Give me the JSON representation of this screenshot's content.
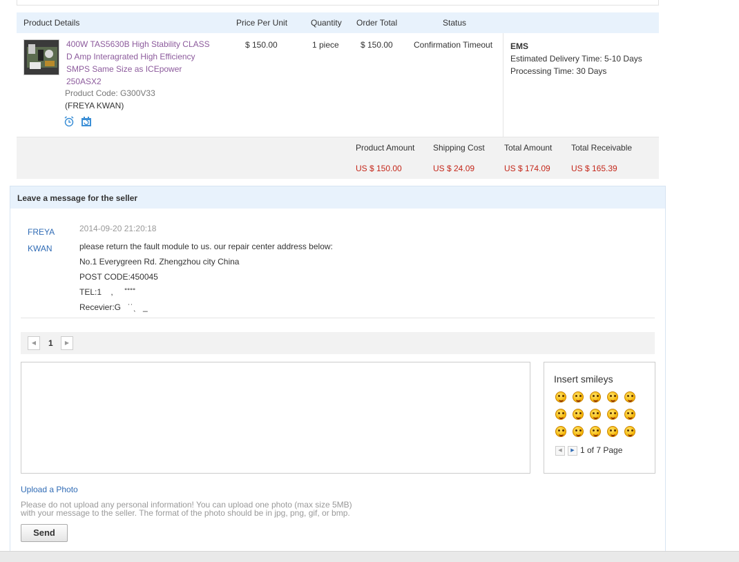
{
  "table_header": {
    "product_details": "Product Details",
    "price_per_unit": "Price Per Unit",
    "quantity": "Quantity",
    "order_total": "Order Total",
    "status": "Status"
  },
  "order": {
    "title_lines": [
      "400W TAS5630B High Stability CLASS",
      "D Amp Interagrated High Efficiency",
      "SMPS Same Size as ICEpower",
      "250ASX2"
    ],
    "product_code": "Product Code: G300V33",
    "buyer": "(FREYA KWAN)",
    "price": "$ 150.00",
    "quantity": "1 piece",
    "order_total": "$ 150.00",
    "status": "Confirmation Timeout",
    "shipping_method": "EMS",
    "delivery_time_label": "Estimated Delivery Time:",
    "delivery_time": "5-10 Days",
    "processing_time_label": "Processing Time:",
    "processing_time": "30 Days",
    "icons": [
      "alarm-clock-icon",
      "calendar-icon"
    ]
  },
  "summary": {
    "product_amount_label": "Product Amount",
    "product_amount": "US $ 150.00",
    "shipping_cost_label": "Shipping Cost",
    "shipping_cost": "US $ 24.09",
    "total_amount_label": "Total Amount",
    "total_amount": "US $ 174.09",
    "total_receivable_label": "Total Receivable",
    "total_receivable": "US $ 165.39"
  },
  "message_section": {
    "heading": "Leave a message for the seller",
    "sender_first": "FREYA",
    "sender_last": "KWAN",
    "timestamp": "2014-09-20 21:20:18",
    "lines": [
      "please return the fault module to us.  our repair center address below:",
      "No.1 Everygreen Rd. Zhengzhou city China",
      "POST CODE:450045",
      "TEL:1    ,     ˚˚˚˚",
      "Recevier:G   ˙˙ˎ   _"
    ],
    "page_number": "1"
  },
  "smileys": {
    "title": "Insert smileys",
    "page_label": "1 of 7 Page",
    "count": 15
  },
  "upload": {
    "link": "Upload a Photo",
    "note_line1": "Please do not upload any personal information! You can upload one photo (max size 5MB)",
    "note_line2": "with your message to the seller. The format of the photo should be in jpg, png, gif, or bmp."
  },
  "send_button": "Send",
  "colors": {
    "header_bg": "#e8f2fc",
    "price_red": "#c4271a",
    "link_blue": "#2f6bb5",
    "product_link": "#8c5a9c"
  }
}
